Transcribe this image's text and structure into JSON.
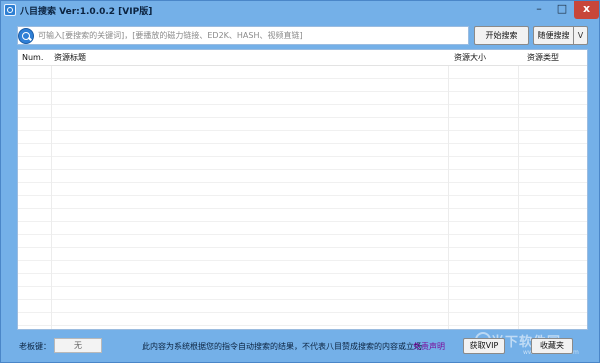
{
  "window": {
    "title": "八目搜索 Ver:1.0.0.2 [VIP版]",
    "minimize_label": "–",
    "maximize_label": "□",
    "close_label": "x"
  },
  "search": {
    "placeholder": "可输入[要搜索的关键词]，[要播放的磁力链接、ED2K、HASH、视频直链]",
    "value": "",
    "start_label": "开始搜索",
    "random_label": "随便搜搜",
    "dropdown_label": "V"
  },
  "table": {
    "columns": [
      "Num.",
      "资源标题",
      "资源大小",
      "资源类型"
    ],
    "rows": []
  },
  "footer": {
    "boss_key_label": "老板键：",
    "boss_key_value": "无",
    "notice": "此内容为系统根据您的指令自动搜索的结果，不代表八目赞成搜索的内容或立场",
    "disclaimer_label": "免责声明",
    "vip_label": "获取VIP",
    "favorite_label": "收藏夹"
  },
  "watermark": {
    "text": "当下软件园",
    "sub": "www.downxia.com"
  },
  "colors": {
    "window_bg": "#74b0e8",
    "close_button": "#c8463a",
    "disclaimer_link": "#7a0a9a"
  },
  "icons": {
    "app": "app-logo-icon",
    "search": "search-icon"
  }
}
